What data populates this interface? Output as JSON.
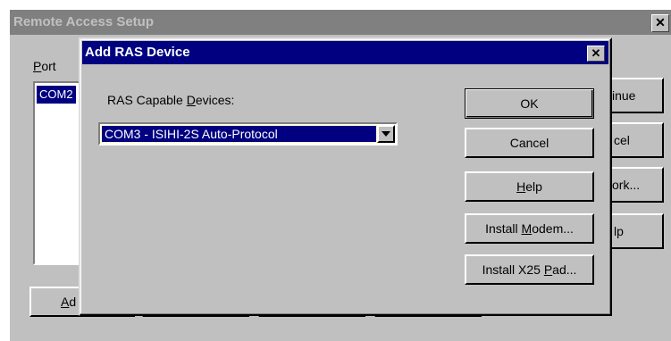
{
  "background_window": {
    "title": "Remote Access Setup",
    "close_glyph": "✕",
    "port_label_prefix": "P",
    "port_label_rest": "ort",
    "port_list": [
      "COM2"
    ],
    "buttons": [
      {
        "label": "inue"
      },
      {
        "label": "cel"
      },
      {
        "label": "ork..."
      },
      {
        "label": "lp"
      }
    ],
    "add_button_prefix": "A",
    "add_button_rest": "d"
  },
  "dialog": {
    "title": "Add RAS Device",
    "close_glyph": "✕",
    "devices_label_pre": "RAS Capable ",
    "devices_label_accel": "D",
    "devices_label_post": "evices:",
    "selected_device": "COM3 - ISIHI-2S Auto-Protocol",
    "dropdown_icon": "triangle-down",
    "buttons": {
      "ok": "OK",
      "cancel": "Cancel",
      "help_accel": "H",
      "help_rest": "elp",
      "modem_pre": "Install ",
      "modem_accel": "M",
      "modem_post": "odem...",
      "x25_pre": "Install X25 ",
      "x25_accel": "P",
      "x25_post": "ad..."
    }
  }
}
